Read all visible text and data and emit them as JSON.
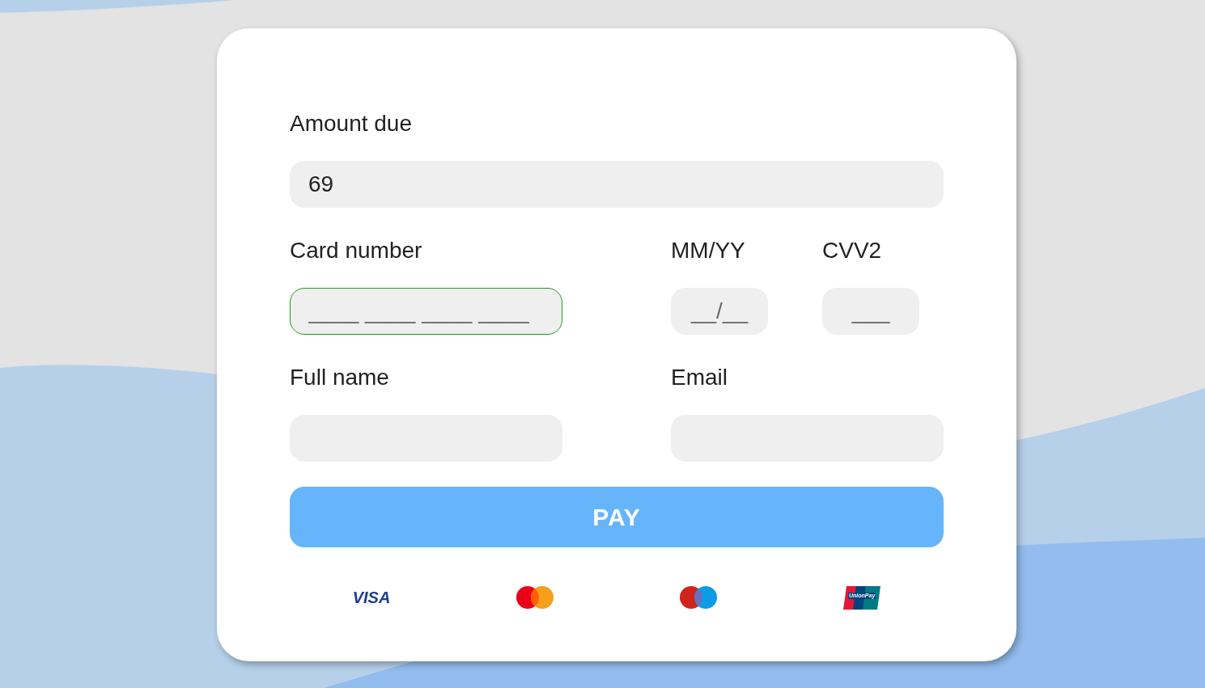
{
  "amount": {
    "label": "Amount due",
    "value": "69"
  },
  "card_number": {
    "label": "Card number",
    "placeholder": "____ ____ ____ ____",
    "focused": true
  },
  "expiry": {
    "label": "MM/YY",
    "placeholder": "__/__",
    "focused": false
  },
  "cvv": {
    "label": "CVV2",
    "placeholder": "___",
    "focused": false
  },
  "full_name": {
    "label": "Full name",
    "focused": false
  },
  "email": {
    "label": "Email",
    "focused": false
  },
  "pay_button": "PAY",
  "logos": [
    {
      "kind": "visa",
      "text": "VISA"
    },
    {
      "kind": "mastercard"
    },
    {
      "kind": "maestro"
    },
    {
      "kind": "unionpay",
      "text": "UnionPay"
    }
  ]
}
